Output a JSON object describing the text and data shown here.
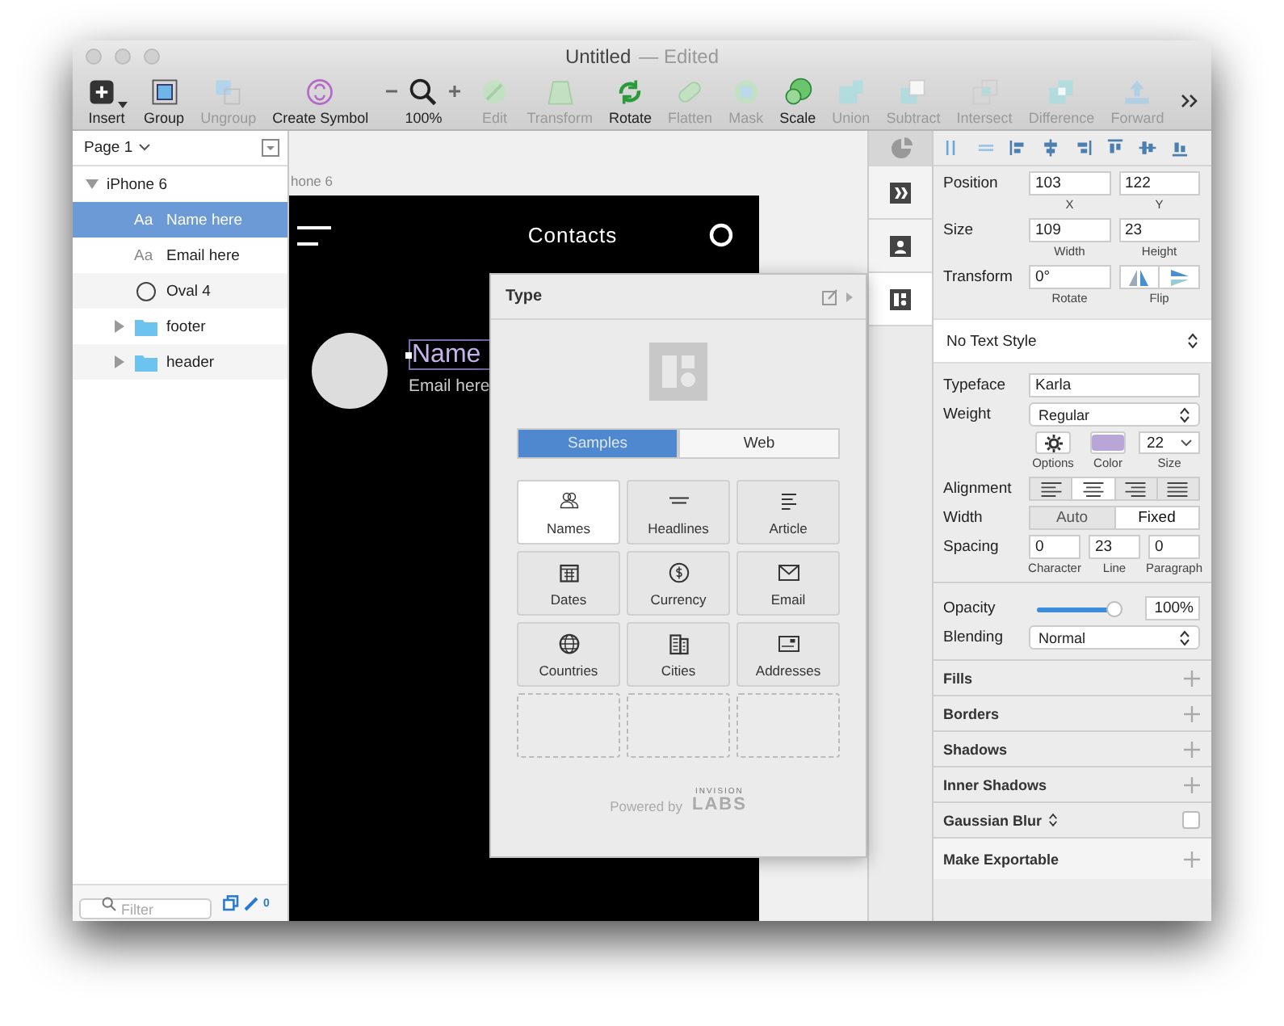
{
  "window": {
    "title": "Untitled",
    "status": "— Edited"
  },
  "toolbar": [
    {
      "label": "Insert",
      "kind": "menu",
      "disabled": false
    },
    {
      "label": "Group",
      "kind": "button",
      "disabled": false
    },
    {
      "label": "Ungroup",
      "kind": "button",
      "disabled": true
    },
    {
      "label": "Create Symbol",
      "kind": "button",
      "disabled": false
    },
    {
      "label": "100%",
      "kind": "zoom",
      "disabled": false
    },
    {
      "label": "Edit",
      "kind": "button",
      "disabled": true
    },
    {
      "label": "Transform",
      "kind": "button",
      "disabled": true
    },
    {
      "label": "Rotate",
      "kind": "button",
      "disabled": false
    },
    {
      "label": "Flatten",
      "kind": "button",
      "disabled": true
    },
    {
      "label": "Mask",
      "kind": "button",
      "disabled": true
    },
    {
      "label": "Scale",
      "kind": "button",
      "disabled": false
    },
    {
      "label": "Union",
      "kind": "button",
      "disabled": true
    },
    {
      "label": "Subtract",
      "kind": "button",
      "disabled": true
    },
    {
      "label": "Intersect",
      "kind": "button",
      "disabled": true
    },
    {
      "label": "Difference",
      "kind": "button",
      "disabled": true
    },
    {
      "label": "Forward",
      "kind": "button",
      "disabled": true
    }
  ],
  "sidebar": {
    "page": "Page 1",
    "layers": [
      {
        "label": "iPhone 6",
        "expanded": true,
        "selected": false,
        "children": [
          {
            "label": "Name here",
            "kind": "text",
            "glyph": "Aa",
            "selected": true
          },
          {
            "label": "Email here",
            "kind": "text",
            "glyph": "Aa",
            "selected": false
          },
          {
            "label": "Oval 4",
            "kind": "oval",
            "selected": false
          },
          {
            "label": "footer",
            "kind": "group",
            "expanded": false,
            "selected": false
          },
          {
            "label": "header",
            "kind": "group",
            "expanded": false,
            "selected": false
          }
        ]
      }
    ],
    "filter": {
      "placeholder": "Filter"
    },
    "count": "0"
  },
  "canvas": {
    "artboard_label": "hone 6",
    "title": "Contacts",
    "name": "Name",
    "email": "Email here"
  },
  "popover": {
    "title": "Type",
    "tabs": [
      {
        "label": "Samples",
        "selected": true
      },
      {
        "label": "Web",
        "selected": false
      }
    ],
    "tiles": [
      {
        "label": "Names",
        "kind": "sample",
        "selected": true
      },
      {
        "label": "Headlines",
        "kind": "sample",
        "selected": false
      },
      {
        "label": "Article",
        "kind": "sample",
        "selected": false
      },
      {
        "label": "Dates",
        "kind": "sample",
        "selected": false
      },
      {
        "label": "Currency",
        "kind": "sample",
        "selected": false
      },
      {
        "label": "Email",
        "kind": "sample",
        "selected": false
      },
      {
        "label": "Countries",
        "kind": "sample",
        "selected": false
      },
      {
        "label": "Cities",
        "kind": "sample",
        "selected": false
      },
      {
        "label": "Addresses",
        "kind": "sample",
        "selected": false
      },
      {
        "kind": "empty"
      },
      {
        "kind": "empty"
      },
      {
        "kind": "empty"
      }
    ],
    "footer": {
      "text": "Powered by",
      "brand_small": "INVISION",
      "brand": "LABS"
    }
  },
  "inspector": {
    "geometry": [
      {
        "label": "Position",
        "fields": [
          {
            "value": "103",
            "caption": "X"
          },
          {
            "value": "122",
            "caption": "Y"
          }
        ]
      },
      {
        "label": "Size",
        "fields": [
          {
            "value": "109",
            "caption": "Width"
          },
          {
            "value": "23",
            "caption": "Height"
          }
        ]
      }
    ],
    "transform": {
      "label": "Transform",
      "value": "0°",
      "caption": "Rotate",
      "flip_caption": "Flip"
    },
    "text_style": "No Text Style",
    "typeface": {
      "label": "Typeface",
      "value": "Karla"
    },
    "weight": {
      "label": "Weight",
      "value": "Regular"
    },
    "options_caption": "Options",
    "color": {
      "caption": "Color",
      "color": "#b9a6d8"
    },
    "size": {
      "value": "22",
      "caption": "Size"
    },
    "alignment": {
      "label": "Alignment",
      "options": [
        {
          "selected": false
        },
        {
          "selected": true
        },
        {
          "selected": false
        },
        {
          "selected": false
        }
      ]
    },
    "width": {
      "label": "Width",
      "options": [
        {
          "label": "Auto",
          "selected": false
        },
        {
          "label": "Fixed",
          "selected": true
        }
      ]
    },
    "spacing": {
      "label": "Spacing",
      "fields": [
        {
          "value": "0",
          "caption": "Character"
        },
        {
          "value": "23",
          "caption": "Line"
        },
        {
          "value": "0",
          "caption": "Paragraph"
        }
      ]
    },
    "opacity": {
      "label": "Opacity",
      "level": 0.95,
      "reading": "100%"
    },
    "blending": {
      "label": "Blending",
      "value": "Normal"
    },
    "sections": [
      {
        "label": "Fills",
        "kind": "add"
      },
      {
        "label": "Borders",
        "kind": "add"
      },
      {
        "label": "Shadows",
        "kind": "add"
      },
      {
        "label": "Inner Shadows",
        "kind": "add"
      },
      {
        "label": "Gaussian Blur",
        "kind": "toggle",
        "checked": false
      },
      {
        "label": "Make Exportable",
        "kind": "add"
      }
    ]
  }
}
